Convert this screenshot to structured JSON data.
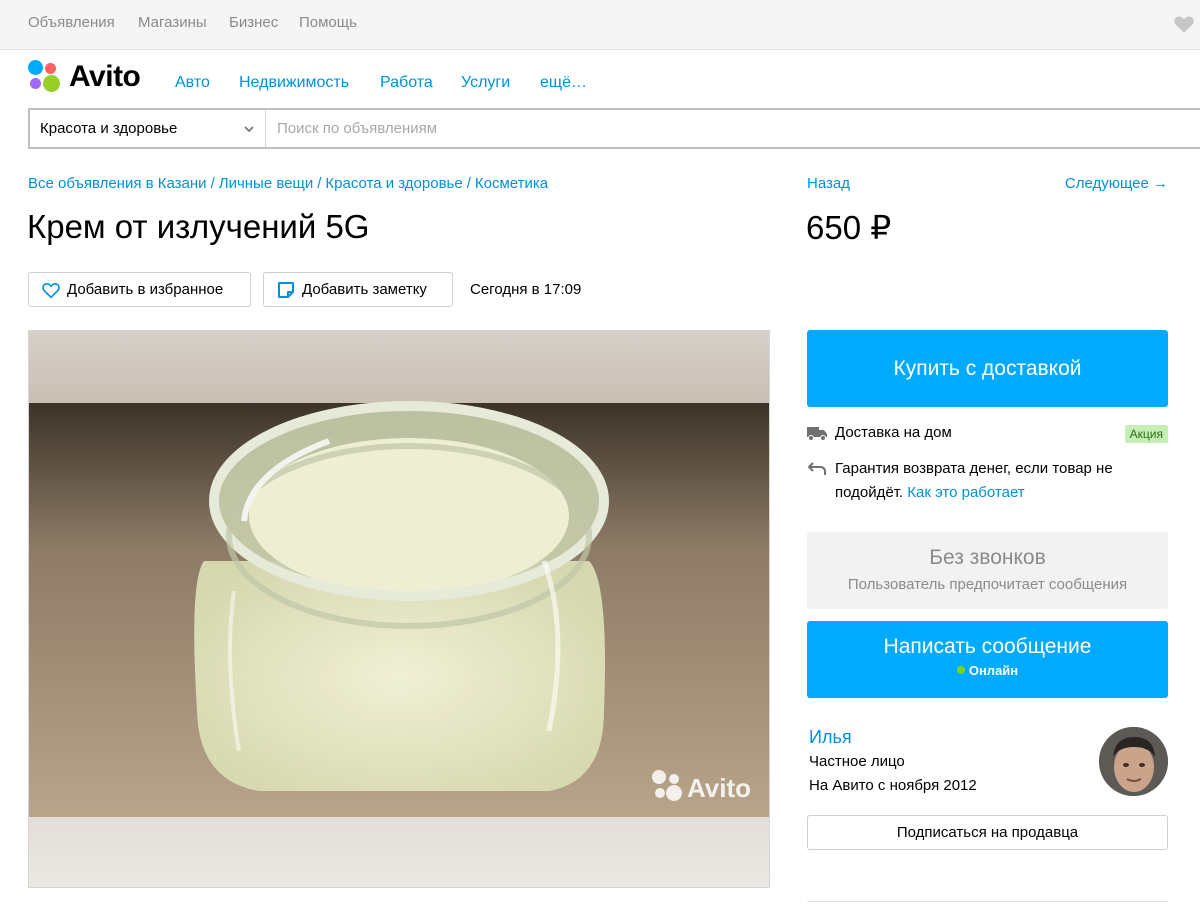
{
  "topbar": {
    "links": [
      "Объявления",
      "Магазины",
      "Бизнес",
      "Помощь"
    ],
    "favorites_icon": "heart-icon"
  },
  "header": {
    "logo_text": "Avito",
    "logo_colors": [
      "#00aaff",
      "#97cf26",
      "#a169f7",
      "#ff6163"
    ],
    "nav": [
      "Авто",
      "Недвижимость",
      "Работа",
      "Услуги",
      "ещё…"
    ]
  },
  "search": {
    "category": "Красота и здоровье",
    "placeholder": "Поиск по объявлениям"
  },
  "breadcrumb": [
    "Все объявления в Казани",
    "Личные вещи",
    "Красота и здоровье",
    "Косметика"
  ],
  "ad": {
    "title": "Крем от излучений 5G",
    "price": "650 ₽",
    "back": "Назад",
    "next": "Следующее →",
    "favorite_label": "Добавить в избранное",
    "note_label": "Добавить заметку",
    "date": "Сегодня в 17:09",
    "watermark": "Avito"
  },
  "purchase": {
    "buy_label": "Купить с доставкой",
    "delivery_label": "Доставка на дом",
    "badge": "Акция",
    "guarantee_text": "Гарантия возврата денег, если товар не подойдёт.",
    "guarantee_link": "Как это работает"
  },
  "contact": {
    "nocalls_title": "Без звонков",
    "nocalls_sub": "Пользователь предпочитает сообщения",
    "message_label": "Написать сообщение",
    "online": "Онлайн"
  },
  "seller": {
    "name": "Илья",
    "type": "Частное лицо",
    "since": "На Авито с ноября 2012",
    "subscribe_label": "Подписаться на продавца"
  },
  "colors": {
    "accent": "#00aaff",
    "link": "#0091d9"
  }
}
